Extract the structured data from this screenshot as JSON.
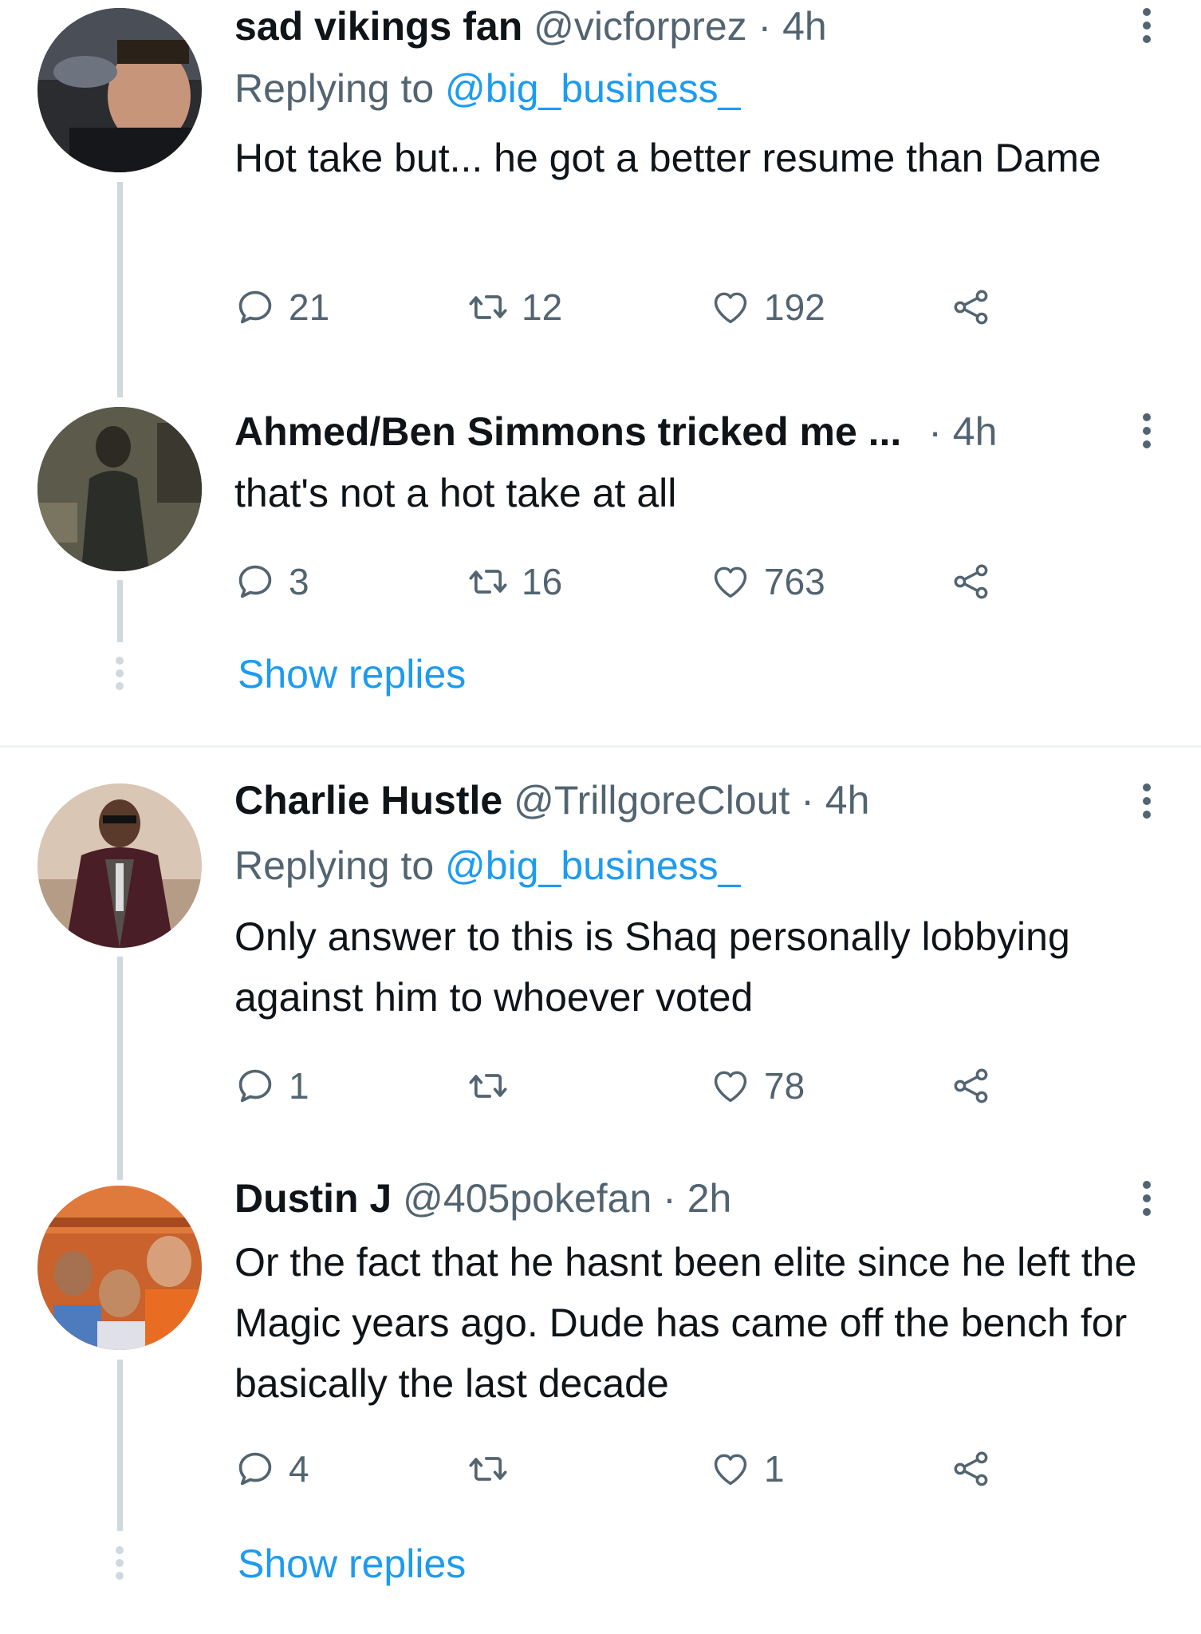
{
  "tweets": [
    {
      "name": "sad vikings fan",
      "handle": "@vicforprez",
      "time": "· 4h",
      "replying_prefix": "Replying to ",
      "replying_to": "@big_business_",
      "text": "Hot take but... he got a better resume than Dame",
      "replies": "21",
      "retweets": "12",
      "likes": "192"
    },
    {
      "name": "Ahmed/Ben Simmons tricked me ...",
      "time": "· 4h",
      "text": "that's not a hot take at all",
      "replies": "3",
      "retweets": "16",
      "likes": "763",
      "show_replies": "Show replies"
    },
    {
      "name": "Charlie Hustle",
      "handle": "@TrillgoreClout",
      "time": "· 4h",
      "replying_prefix": "Replying to ",
      "replying_to": "@big_business_",
      "text": "Only answer to this is Shaq personally lobbying against him to whoever voted",
      "replies": "1",
      "retweets": "",
      "likes": "78"
    },
    {
      "name": "Dustin J",
      "handle": "@405pokefan",
      "time": "· 2h",
      "text": "Or the fact that he hasnt been elite since he left the Magic years ago. Dude has came off the bench for basically the last decade",
      "replies": "4",
      "retweets": "",
      "likes": "1",
      "show_replies": "Show replies"
    }
  ],
  "colors": {
    "link": "#1d9bf0",
    "muted": "#536471",
    "text": "#0f1419",
    "thread_line": "#cfd9de"
  },
  "icons": [
    "reply-icon",
    "retweet-icon",
    "like-icon",
    "share-icon",
    "more-options-icon"
  ]
}
